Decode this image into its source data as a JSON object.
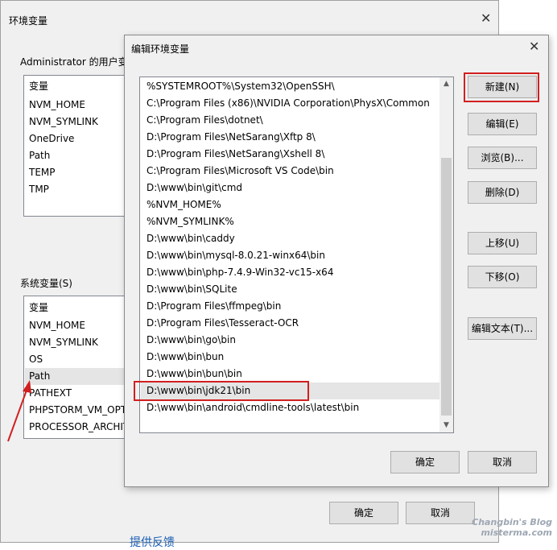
{
  "background_dialog": {
    "title": "环境变量",
    "close_glyph": "✕",
    "user_group_label": "Administrator 的用户变",
    "user_vars": {
      "header": "变量",
      "items": [
        "NVM_HOME",
        "NVM_SYMLINK",
        "OneDrive",
        "Path",
        "TEMP",
        "TMP"
      ]
    },
    "system_group_label": "系统变量(S)",
    "system_vars": {
      "header": "变量",
      "items": [
        "NVM_HOME",
        "NVM_SYMLINK",
        "OS",
        "Path",
        "PATHEXT",
        "PHPSTORM_VM_OPT",
        "PROCESSOR_ARCHIT"
      ],
      "selected": "Path"
    },
    "ok_label": "确定",
    "cancel_label": "取消",
    "bottom_partial_text": "提供反馈"
  },
  "edit_dialog": {
    "title": "编辑环境变量",
    "close_glyph": "✕",
    "paths": [
      "%SYSTEMROOT%\\System32\\OpenSSH\\",
      "C:\\Program Files (x86)\\NVIDIA Corporation\\PhysX\\Common",
      "C:\\Program Files\\dotnet\\",
      "D:\\Program Files\\NetSarang\\Xftp 8\\",
      "D:\\Program Files\\NetSarang\\Xshell 8\\",
      "C:\\Program Files\\Microsoft VS Code\\bin",
      "D:\\www\\bin\\git\\cmd",
      "%NVM_HOME%",
      "%NVM_SYMLINK%",
      "D:\\www\\bin\\caddy",
      "D:\\www\\bin\\mysql-8.0.21-winx64\\bin",
      "D:\\www\\bin\\php-7.4.9-Win32-vc15-x64",
      "D:\\www\\bin\\SQLite",
      "D:\\Program Files\\ffmpeg\\bin",
      "D:\\Program Files\\Tesseract-OCR",
      "D:\\www\\bin\\go\\bin",
      "D:\\www\\bin\\bun",
      "D:\\www\\bin\\bun\\bin",
      "D:\\www\\bin\\jdk21\\bin",
      "D:\\www\\bin\\android\\cmdline-tools\\latest\\bin"
    ],
    "selected_path": "D:\\www\\bin\\jdk21\\bin",
    "buttons": {
      "new": "新建(N)",
      "edit": "编辑(E)",
      "browse": "浏览(B)...",
      "delete": "删除(D)",
      "move_up": "上移(U)",
      "move_down": "下移(O)",
      "edit_text": "编辑文本(T)..."
    },
    "ok_label": "确定",
    "cancel_label": "取消"
  },
  "watermark": {
    "line1": "Changbin's Blog",
    "line2": "misterma.com"
  },
  "colors": {
    "highlight_red": "#d21f1f",
    "dialog_bg": "#f0f0f0",
    "selection_bg": "#e5e5e5"
  }
}
